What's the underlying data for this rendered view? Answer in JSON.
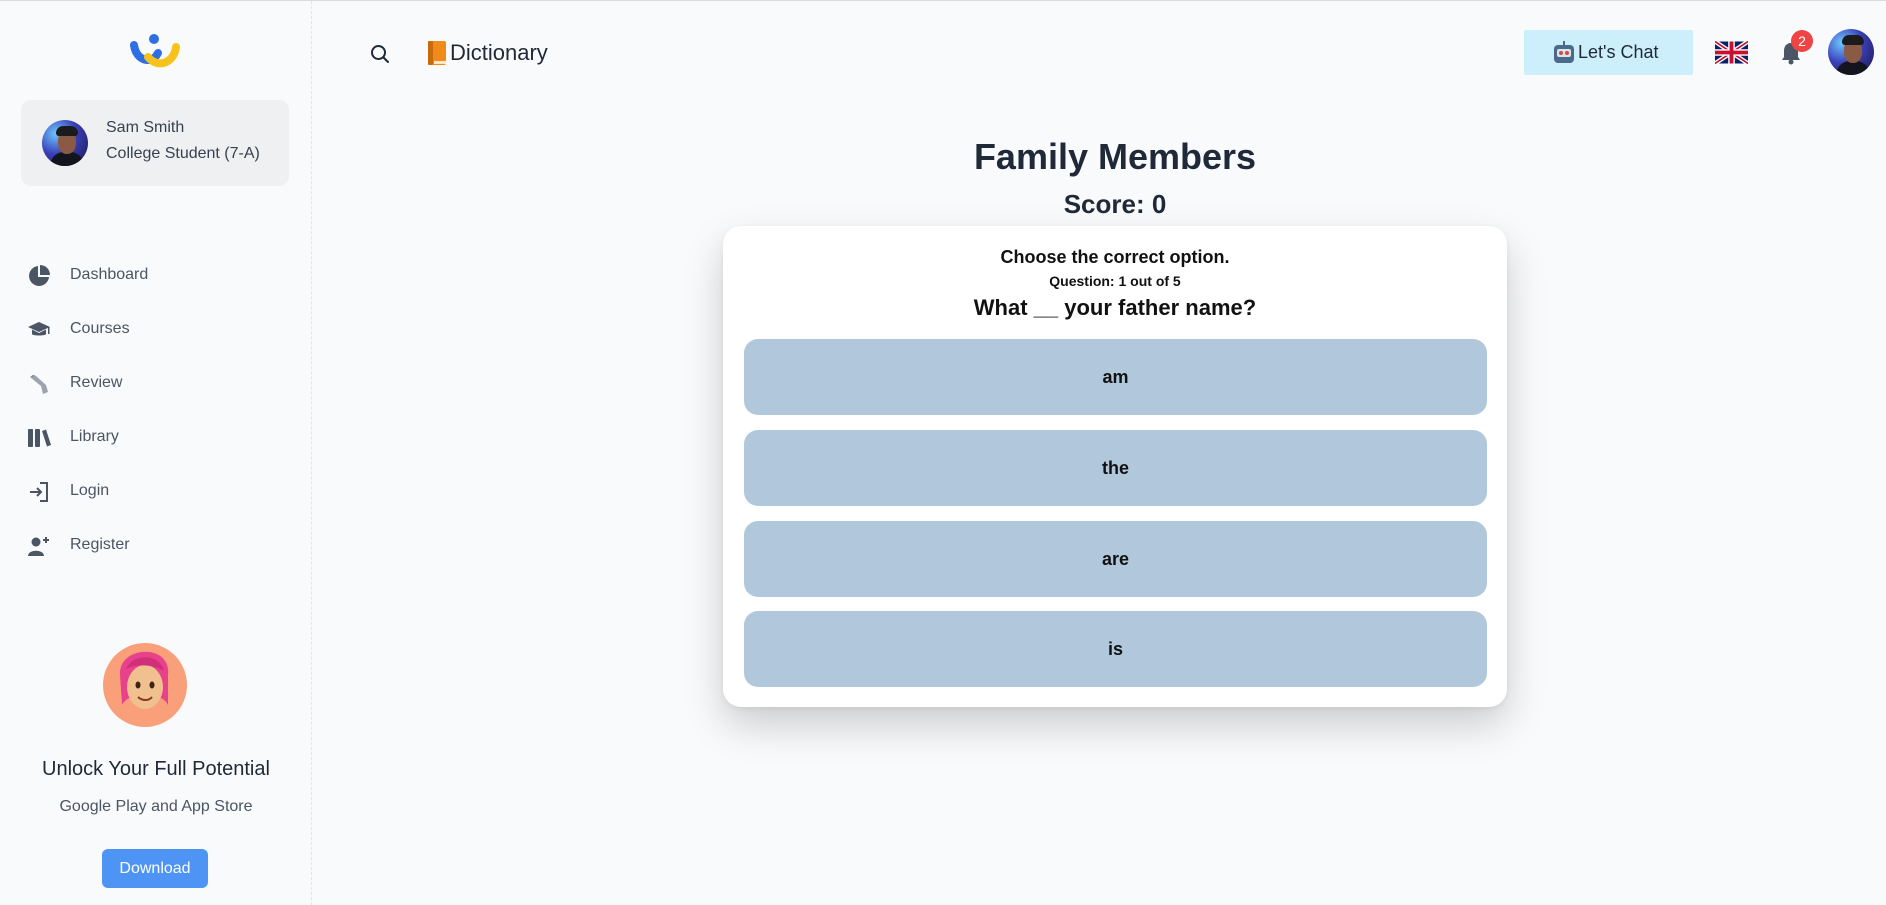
{
  "sidebar": {
    "profile": {
      "name": "Sam Smith",
      "role": "College Student (7-A)"
    },
    "nav": [
      {
        "label": "Dashboard",
        "icon": "pie-chart-icon"
      },
      {
        "label": "Courses",
        "icon": "graduation-cap-icon"
      },
      {
        "label": "Review",
        "icon": "hand-icon"
      },
      {
        "label": "Library",
        "icon": "books-icon"
      },
      {
        "label": "Login",
        "icon": "login-icon"
      },
      {
        "label": "Register",
        "icon": "add-user-icon"
      }
    ],
    "promo": {
      "title": "Unlock Your Full Potential",
      "subtitle": "Google Play and App Store",
      "button": "Download"
    }
  },
  "header": {
    "dictionary_label": "Dictionary",
    "chat_label": "Let's Chat",
    "notification_count": "2",
    "language": "English (UK flag)"
  },
  "quiz": {
    "title": "Family Members",
    "score": "Score: 0",
    "instruction": "Choose the correct option.",
    "progress": "Question: 1 out of 5",
    "question": "What __ your father name?",
    "options": [
      "am",
      "the",
      "are",
      "is"
    ]
  },
  "colors": {
    "option_bg": "#b1c8dc",
    "download_btn": "#4d94f5",
    "chat_btn_bg": "#cdeffb",
    "badge": "#ef4444"
  }
}
